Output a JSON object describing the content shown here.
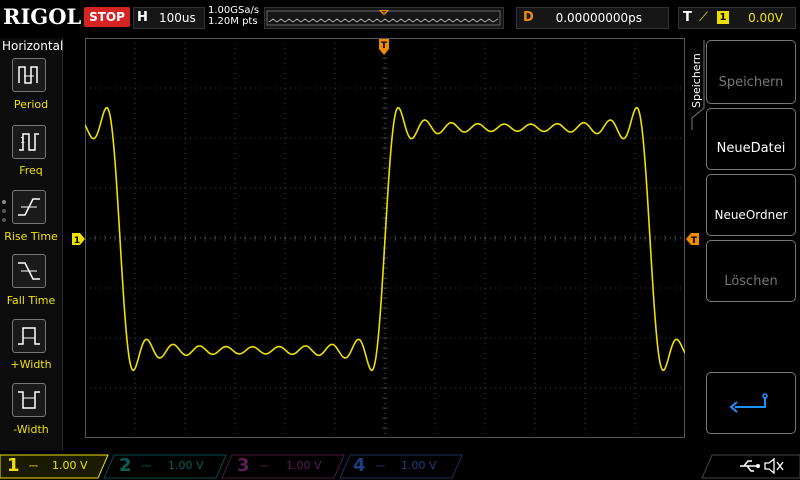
{
  "header": {
    "logo": "RIGOL",
    "run_status": "STOP",
    "timebase_label": "H",
    "timebase_value": "100us",
    "sample_rate": "1.00GSa/s",
    "memory_points": "1.20M pts",
    "delay_label": "D",
    "delay_value": "0.00000000ps",
    "trigger_label": "T",
    "trigger_source": "1",
    "trigger_level": "0.00V"
  },
  "left_menu": {
    "title": "Horizontal",
    "items": [
      {
        "label": "Period"
      },
      {
        "label": "Freq"
      },
      {
        "label": "Rise Time"
      },
      {
        "label": "Fall Time"
      },
      {
        "label": "+Width"
      },
      {
        "label": "-Width"
      }
    ]
  },
  "right_menu": {
    "title": "Speichern",
    "buttons": [
      {
        "label": "Speichern"
      },
      {
        "label": "NeueDatei"
      },
      {
        "label": "NeueOrdner"
      },
      {
        "label": "Löschen"
      }
    ]
  },
  "markers": {
    "trigger_position": "T",
    "channel_ground": "1"
  },
  "channels": [
    {
      "number": "1",
      "value": "1.00 V",
      "color": "#f0e000"
    },
    {
      "number": "2",
      "value": "1.00 V",
      "color": "#0fb5a8"
    },
    {
      "number": "3",
      "value": "1.00 V",
      "color": "#c03aa8"
    },
    {
      "number": "4",
      "value": "1.00 V",
      "color": "#2a66d6"
    }
  ],
  "colors": {
    "trace": "#f0e000",
    "accent": "#f08c00",
    "stop": "#d42424"
  }
}
